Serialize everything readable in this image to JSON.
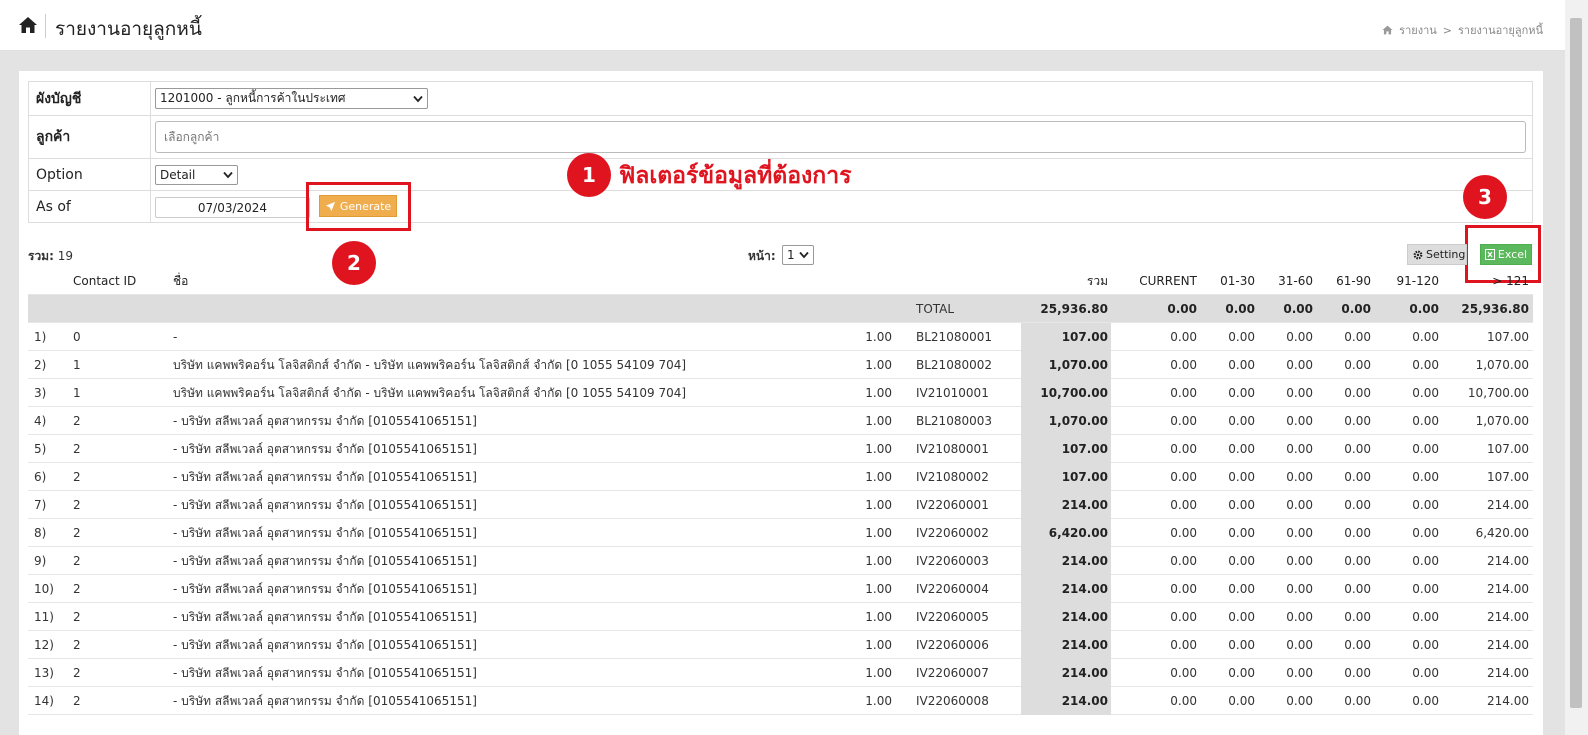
{
  "header": {
    "title": "รายงานอายุลูกหนี้",
    "breadcrumb": [
      "รายงาน",
      ">",
      "รายงานอายุลูกหนี้"
    ]
  },
  "filters": {
    "account_label": "ผังบัญชี",
    "account_value": "1201000 - ลูกหนี้การค้าในประเทศ",
    "customer_label": "ลูกค้า",
    "customer_placeholder": "เลือกลูกค้า",
    "option_label": "Option",
    "option_value": "Detail",
    "asof_label": "As of",
    "asof_value": "07/03/2024",
    "generate_label": "Generate"
  },
  "annotations": {
    "badge1": "1",
    "badge2": "2",
    "badge3": "3",
    "note1": "ฟิลเตอร์ข้อมูลที่ต้องการ"
  },
  "toolbar": {
    "count_label": "รวม:",
    "count_value": "19",
    "page_label": "หน้า:",
    "page_value": "1",
    "setting_label": "Setting",
    "excel_label": "Excel"
  },
  "table": {
    "columns": [
      "Contact ID",
      "ชื่อ",
      "รวม",
      "CURRENT",
      "01-30",
      "31-60",
      "61-90",
      "91-120",
      "> 121"
    ],
    "total": {
      "label": "TOTAL",
      "sum": "25,936.80",
      "current": "0.00",
      "a": "0.00",
      "b": "0.00",
      "c": "0.00",
      "d": "0.00",
      "e": "25,936.80"
    },
    "rows": [
      {
        "no": "1)",
        "id": "0",
        "name": "-",
        "rate": "1.00",
        "doc": "BL21080001",
        "sum": "107.00",
        "current": "0.00",
        "a": "0.00",
        "b": "0.00",
        "c": "0.00",
        "d": "0.00",
        "e": "107.00"
      },
      {
        "no": "2)",
        "id": "1",
        "name": "บริษัท แคพพริคอร์น โลจิสติกส์ จำกัด - บริษัท แคพพริคอร์น โลจิสติกส์ จำกัด [0 1055 54109 704]",
        "rate": "1.00",
        "doc": "BL21080002",
        "sum": "1,070.00",
        "current": "0.00",
        "a": "0.00",
        "b": "0.00",
        "c": "0.00",
        "d": "0.00",
        "e": "1,070.00"
      },
      {
        "no": "3)",
        "id": "1",
        "name": "บริษัท แคพพริคอร์น โลจิสติกส์ จำกัด - บริษัท แคพพริคอร์น โลจิสติกส์ จำกัด [0 1055 54109 704]",
        "rate": "1.00",
        "doc": "IV21010001",
        "sum": "10,700.00",
        "current": "0.00",
        "a": "0.00",
        "b": "0.00",
        "c": "0.00",
        "d": "0.00",
        "e": "10,700.00"
      },
      {
        "no": "4)",
        "id": "2",
        "name": "- บริษัท สลีพเวลล์ อุตสาหกรรม จำกัด [0105541065151]",
        "rate": "1.00",
        "doc": "BL21080003",
        "sum": "1,070.00",
        "current": "0.00",
        "a": "0.00",
        "b": "0.00",
        "c": "0.00",
        "d": "0.00",
        "e": "1,070.00"
      },
      {
        "no": "5)",
        "id": "2",
        "name": "- บริษัท สลีพเวลล์ อุตสาหกรรม จำกัด [0105541065151]",
        "rate": "1.00",
        "doc": "IV21080001",
        "sum": "107.00",
        "current": "0.00",
        "a": "0.00",
        "b": "0.00",
        "c": "0.00",
        "d": "0.00",
        "e": "107.00"
      },
      {
        "no": "6)",
        "id": "2",
        "name": "- บริษัท สลีพเวลล์ อุตสาหกรรม จำกัด [0105541065151]",
        "rate": "1.00",
        "doc": "IV21080002",
        "sum": "107.00",
        "current": "0.00",
        "a": "0.00",
        "b": "0.00",
        "c": "0.00",
        "d": "0.00",
        "e": "107.00"
      },
      {
        "no": "7)",
        "id": "2",
        "name": "- บริษัท สลีพเวลล์ อุตสาหกรรม จำกัด [0105541065151]",
        "rate": "1.00",
        "doc": "IV22060001",
        "sum": "214.00",
        "current": "0.00",
        "a": "0.00",
        "b": "0.00",
        "c": "0.00",
        "d": "0.00",
        "e": "214.00"
      },
      {
        "no": "8)",
        "id": "2",
        "name": "- บริษัท สลีพเวลล์ อุตสาหกรรม จำกัด [0105541065151]",
        "rate": "1.00",
        "doc": "IV22060002",
        "sum": "6,420.00",
        "current": "0.00",
        "a": "0.00",
        "b": "0.00",
        "c": "0.00",
        "d": "0.00",
        "e": "6,420.00"
      },
      {
        "no": "9)",
        "id": "2",
        "name": "- บริษัท สลีพเวลล์ อุตสาหกรรม จำกัด [0105541065151]",
        "rate": "1.00",
        "doc": "IV22060003",
        "sum": "214.00",
        "current": "0.00",
        "a": "0.00",
        "b": "0.00",
        "c": "0.00",
        "d": "0.00",
        "e": "214.00"
      },
      {
        "no": "10)",
        "id": "2",
        "name": "- บริษัท สลีพเวลล์ อุตสาหกรรม จำกัด [0105541065151]",
        "rate": "1.00",
        "doc": "IV22060004",
        "sum": "214.00",
        "current": "0.00",
        "a": "0.00",
        "b": "0.00",
        "c": "0.00",
        "d": "0.00",
        "e": "214.00"
      },
      {
        "no": "11)",
        "id": "2",
        "name": "- บริษัท สลีพเวลล์ อุตสาหกรรม จำกัด [0105541065151]",
        "rate": "1.00",
        "doc": "IV22060005",
        "sum": "214.00",
        "current": "0.00",
        "a": "0.00",
        "b": "0.00",
        "c": "0.00",
        "d": "0.00",
        "e": "214.00"
      },
      {
        "no": "12)",
        "id": "2",
        "name": "- บริษัท สลีพเวลล์ อุตสาหกรรม จำกัด [0105541065151]",
        "rate": "1.00",
        "doc": "IV22060006",
        "sum": "214.00",
        "current": "0.00",
        "a": "0.00",
        "b": "0.00",
        "c": "0.00",
        "d": "0.00",
        "e": "214.00"
      },
      {
        "no": "13)",
        "id": "2",
        "name": "- บริษัท สลีพเวลล์ อุตสาหกรรม จำกัด [0105541065151]",
        "rate": "1.00",
        "doc": "IV22060007",
        "sum": "214.00",
        "current": "0.00",
        "a": "0.00",
        "b": "0.00",
        "c": "0.00",
        "d": "0.00",
        "e": "214.00"
      },
      {
        "no": "14)",
        "id": "2",
        "name": "- บริษัท สลีพเวลล์ อุตสาหกรรม จำกัด [0105541065151]",
        "rate": "1.00",
        "doc": "IV22060008",
        "sum": "214.00",
        "current": "0.00",
        "a": "0.00",
        "b": "0.00",
        "c": "0.00",
        "d": "0.00",
        "e": "214.00"
      }
    ]
  }
}
